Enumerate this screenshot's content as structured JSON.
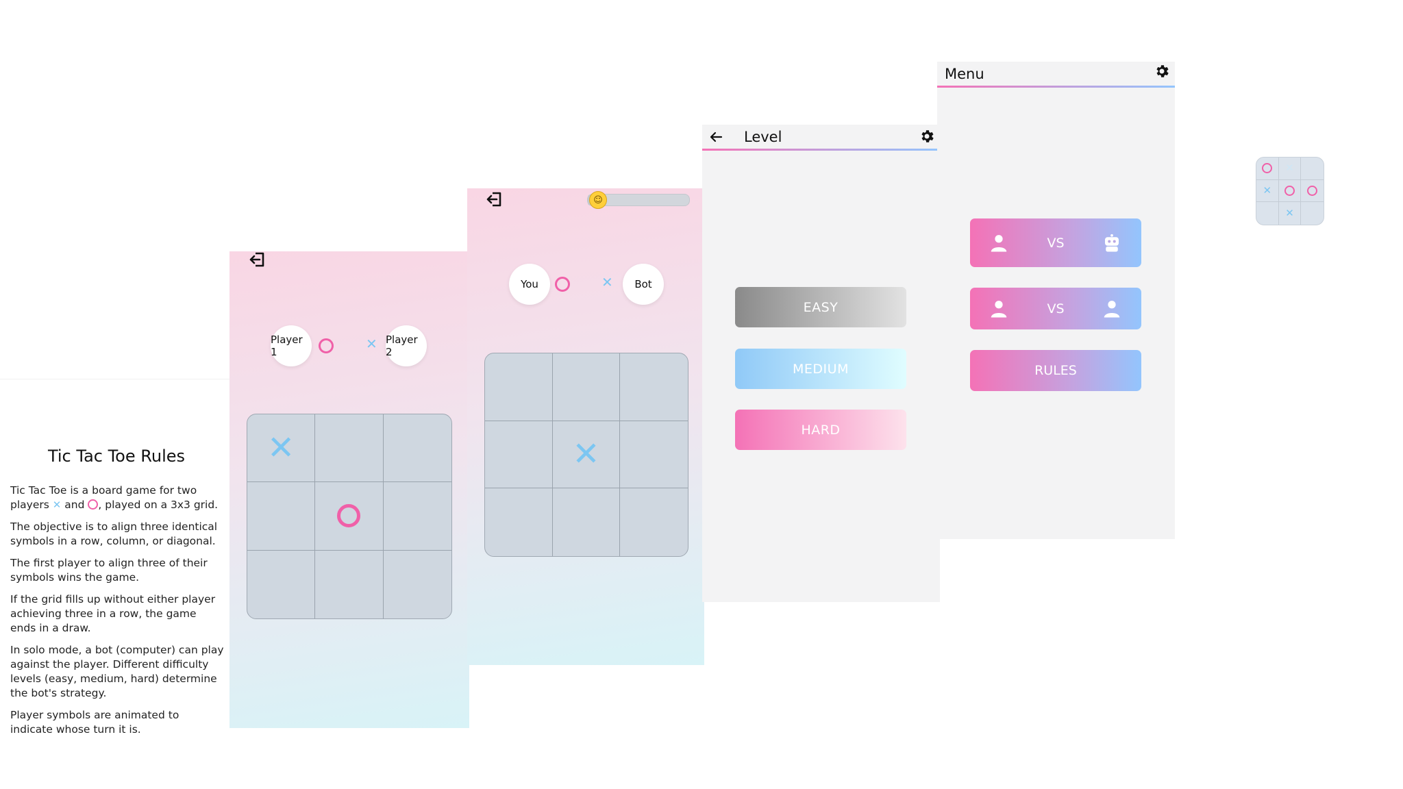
{
  "rules": {
    "title": "Tic Tac Toe Rules",
    "p1_a": "Tic Tac Toe is a board game for two players",
    "p1_b": "and",
    "p1_c": ", played on a 3x3 grid.",
    "p2": "The objective is to align three identical symbols in a row, column, or diagonal.",
    "p3": "The first player to align three of their symbols wins the game.",
    "p4": "If the grid fills up without either player achieving three in a row, the game ends in a draw.",
    "p5": "In solo mode, a bot (computer) can play against the player. Different difficulty levels (easy, medium, hard) determine the bot's strategy.",
    "p6": "Player symbols are animated to indicate whose turn it is."
  },
  "pvp": {
    "player1": "Player 1",
    "player2": "Player 2",
    "board": [
      "X",
      "",
      "",
      "",
      "O",
      "",
      "",
      "",
      ""
    ]
  },
  "bot": {
    "you": "You",
    "bot": "Bot",
    "progress_fraction": 0.05,
    "board": [
      "",
      "",
      "",
      "",
      "X",
      "",
      "",
      "",
      ""
    ]
  },
  "level": {
    "title": "Level",
    "easy": "EASY",
    "medium": "MEDIUM",
    "hard": "HARD"
  },
  "menu": {
    "title": "Menu",
    "vs_bot": "VS",
    "vs_player": "VS",
    "rules": "RULES"
  },
  "icon_board": [
    "O",
    "x-faint",
    "",
    "X",
    "O",
    "O",
    "",
    "X",
    ""
  ],
  "colors": {
    "o_pink": "#f060a8",
    "x_blue": "#7cc6f2",
    "easy_gradient": [
      "#8a8a8a",
      "#e2e2e2"
    ],
    "medium_gradient": [
      "#90c9f7",
      "#e0fdff"
    ],
    "hard_gradient": [
      "#f472b6",
      "#fde2ec"
    ]
  }
}
